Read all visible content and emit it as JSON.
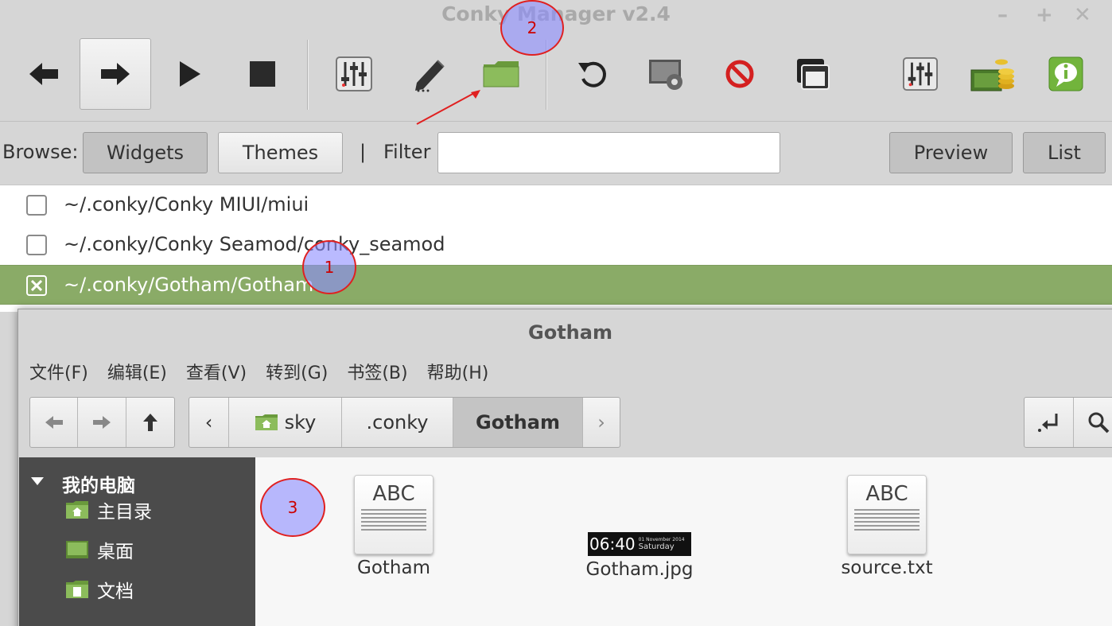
{
  "app": {
    "title": "Conky Manager v2.4",
    "window_controls": [
      "–",
      "+",
      "✕"
    ]
  },
  "toolbar": {
    "buttons": [
      "back-icon",
      "forward-icon",
      "play-icon",
      "stop-icon",
      "settings-sliders-icon",
      "edit-pen-icon",
      "folder-icon",
      "refresh-icon",
      "screenshot-settings-icon",
      "kill-icon",
      "windows-icon",
      "app-settings-icon",
      "donate-icon",
      "info-icon"
    ]
  },
  "browse": {
    "label": "Browse:",
    "widgets_label": "Widgets",
    "themes_label": "Themes",
    "separator": "|",
    "filter_label": "Filter",
    "filter_value": "",
    "preview_label": "Preview",
    "list_label": "List"
  },
  "widget_list": [
    {
      "path": "~/.conky/Conky MIUI/miui",
      "checked": false
    },
    {
      "path": "~/.conky/Conky Seamod/conky_seamod",
      "checked": false
    },
    {
      "path": "~/.conky/Gotham/Gotham",
      "checked": true
    }
  ],
  "file_manager": {
    "title": "Gotham",
    "menu": [
      "文件(F)",
      "编辑(E)",
      "查看(V)",
      "转到(G)",
      "书签(B)",
      "帮助(H)"
    ],
    "breadcrumb": {
      "prev": "‹",
      "next": "›",
      "items": [
        "sky",
        ".conky",
        "Gotham"
      ]
    },
    "sidebar": {
      "header": "我的电脑",
      "items": [
        "主目录",
        "桌面",
        "文档"
      ]
    },
    "files": [
      {
        "name": "Gotham",
        "icon": "text-file-icon",
        "preview": "ABC"
      },
      {
        "name": "Gotham.jpg",
        "icon": "image-thumbnail",
        "thumb_time": "06:40",
        "thumb_day": "Saturday",
        "thumb_small": "01 November 2014"
      },
      {
        "name": "source.txt",
        "icon": "text-file-icon",
        "preview": "ABC"
      }
    ]
  },
  "annotations": [
    "1",
    "2",
    "3"
  ],
  "colors": {
    "selection": "#8aab67",
    "sidebar": "#4b4b4b",
    "annotation_border": "#e02020"
  }
}
